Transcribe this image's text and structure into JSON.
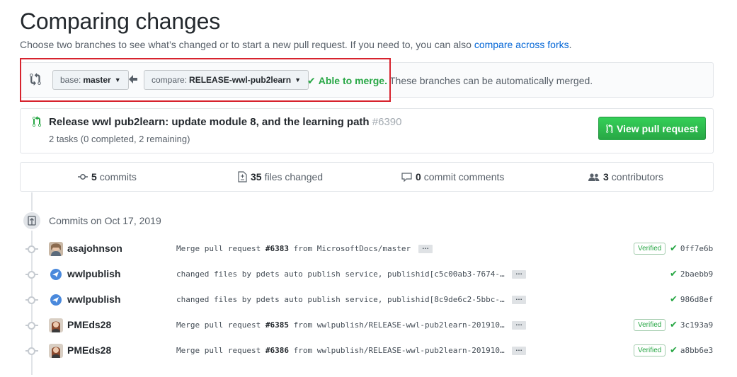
{
  "header": {
    "title": "Comparing changes",
    "subtitle_text": "Choose two branches to see what’s changed or to start a new pull request. If you need to, you can also ",
    "subtitle_link": "compare across forks",
    "subtitle_end": "."
  },
  "range": {
    "base_prefix": "base:",
    "base_value": "master",
    "compare_prefix": "compare:",
    "compare_value": "RELEASE-wwl-pub2learn",
    "merge_status": "Able to merge.",
    "merge_message": "These branches can be automatically merged."
  },
  "pull_request": {
    "title": "Release wwl pub2learn: update module 8, and the learning path",
    "number": "#6390",
    "tasks": "2 tasks (0 completed, 2 remaining)",
    "view_button": "View pull request"
  },
  "summary": {
    "commits_count": "5",
    "commits_label": "commits",
    "files_count": "35",
    "files_label": "files changed",
    "comments_count": "0",
    "comments_label": "commit comments",
    "contributors_count": "3",
    "contributors_label": "contributors"
  },
  "commits_group": {
    "date_label": "Commits on Oct 17, 2019"
  },
  "commits": [
    {
      "author": "asajohnson",
      "msg_prefix": "Merge pull request ",
      "pr": "#6383",
      "msg_suffix": " from MicrosoftDocs/master",
      "verified": "Verified",
      "sha": "0ff7e6b"
    },
    {
      "author": "wwlpublish",
      "msg_prefix": "changed files by pdets auto publish service, publishid[c5c00ab3-7674-…",
      "pr": "",
      "msg_suffix": "",
      "verified": "",
      "sha": "2baebb9"
    },
    {
      "author": "wwlpublish",
      "msg_prefix": "changed files by pdets auto publish service, publishid[8c9de6c2-5bbc-…",
      "pr": "",
      "msg_suffix": "",
      "verified": "",
      "sha": "986d8ef"
    },
    {
      "author": "PMEds28",
      "msg_prefix": "Merge pull request ",
      "pr": "#6385",
      "msg_suffix": " from wwlpublish/RELEASE-wwl-pub2learn-201910…",
      "verified": "Verified",
      "sha": "3c193a9"
    },
    {
      "author": "PMEds28",
      "msg_prefix": "Merge pull request ",
      "pr": "#6386",
      "msg_suffix": " from wwlpublish/RELEASE-wwl-pub2learn-201910…",
      "verified": "Verified",
      "sha": "a8bb6e3"
    }
  ],
  "ellipsis_label": "…",
  "colors": {
    "link": "#0366d6",
    "success": "#28a745",
    "highlight_border": "#d7232e"
  }
}
